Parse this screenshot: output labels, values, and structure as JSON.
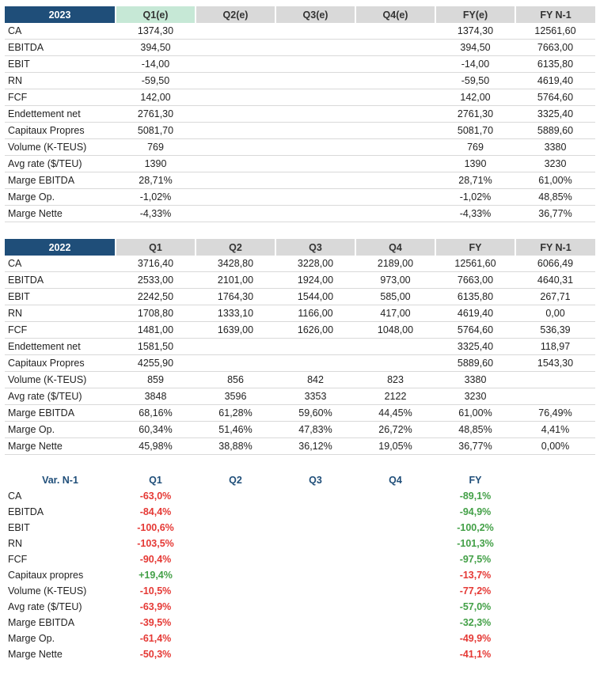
{
  "table_2023": {
    "headers": [
      "2023",
      "Q1(e)",
      "Q2(e)",
      "Q3(e)",
      "Q4(e)",
      "FY(e)",
      "FY N-1"
    ],
    "rows": [
      [
        "CA",
        "1374,30",
        "",
        "",
        "",
        "1374,30",
        "12561,60"
      ],
      [
        "EBITDA",
        "394,50",
        "",
        "",
        "",
        "394,50",
        "7663,00"
      ],
      [
        "EBIT",
        "-14,00",
        "",
        "",
        "",
        "-14,00",
        "6135,80"
      ],
      [
        "RN",
        "-59,50",
        "",
        "",
        "",
        "-59,50",
        "4619,40"
      ],
      [
        "FCF",
        "142,00",
        "",
        "",
        "",
        "142,00",
        "5764,60"
      ],
      [
        "Endettement net",
        "2761,30",
        "",
        "",
        "",
        "2761,30",
        "3325,40"
      ],
      [
        "Capitaux Propres",
        "5081,70",
        "",
        "",
        "",
        "5081,70",
        "5889,60"
      ],
      [
        "Volume (K-TEUS)",
        "769",
        "",
        "",
        "",
        "769",
        "3380"
      ],
      [
        "Avg rate ($/TEU)",
        "1390",
        "",
        "",
        "",
        "1390",
        "3230"
      ],
      [
        "Marge EBITDA",
        "28,71%",
        "",
        "",
        "",
        "28,71%",
        "61,00%"
      ],
      [
        "Marge Op.",
        "-1,02%",
        "",
        "",
        "",
        "-1,02%",
        "48,85%"
      ],
      [
        "Marge Nette",
        "-4,33%",
        "",
        "",
        "",
        "-4,33%",
        "36,77%"
      ]
    ]
  },
  "table_2022": {
    "headers": [
      "2022",
      "Q1",
      "Q2",
      "Q3",
      "Q4",
      "FY",
      "FY N-1"
    ],
    "rows": [
      [
        "CA",
        "3716,40",
        "3428,80",
        "3228,00",
        "2189,00",
        "12561,60",
        "6066,49"
      ],
      [
        "EBITDA",
        "2533,00",
        "2101,00",
        "1924,00",
        "973,00",
        "7663,00",
        "4640,31"
      ],
      [
        "EBIT",
        "2242,50",
        "1764,30",
        "1544,00",
        "585,00",
        "6135,80",
        "267,71"
      ],
      [
        "RN",
        "1708,80",
        "1333,10",
        "1166,00",
        "417,00",
        "4619,40",
        "0,00"
      ],
      [
        "FCF",
        "1481,00",
        "1639,00",
        "1626,00",
        "1048,00",
        "5764,60",
        "536,39"
      ],
      [
        "Endettement net",
        "1581,50",
        "",
        "",
        "",
        "3325,40",
        "118,97"
      ],
      [
        "Capitaux Propres",
        "4255,90",
        "",
        "",
        "",
        "5889,60",
        "1543,30"
      ],
      [
        "Volume (K-TEUS)",
        "859",
        "856",
        "842",
        "823",
        "3380",
        ""
      ],
      [
        "Avg rate ($/TEU)",
        "3848",
        "3596",
        "3353",
        "2122",
        "3230",
        ""
      ],
      [
        "Marge EBITDA",
        "68,16%",
        "61,28%",
        "59,60%",
        "44,45%",
        "61,00%",
        "76,49%"
      ],
      [
        "Marge Op.",
        "60,34%",
        "51,46%",
        "47,83%",
        "26,72%",
        "48,85%",
        "4,41%"
      ],
      [
        "Marge Nette",
        "45,98%",
        "38,88%",
        "36,12%",
        "19,05%",
        "36,77%",
        "0,00%"
      ]
    ]
  },
  "table_var": {
    "headers": [
      "Var. N-1",
      "Q1",
      "Q2",
      "Q3",
      "Q4",
      "FY"
    ],
    "rows": [
      [
        "CA",
        "-63,0%",
        "",
        "",
        "",
        "-89,1%"
      ],
      [
        "EBITDA",
        "-84,4%",
        "",
        "",
        "",
        "-94,9%"
      ],
      [
        "EBIT",
        "-100,6%",
        "",
        "",
        "",
        "-100,2%"
      ],
      [
        "RN",
        "-103,5%",
        "",
        "",
        "",
        "-101,3%"
      ],
      [
        "FCF",
        "-90,4%",
        "",
        "",
        "",
        "-97,5%"
      ],
      [
        "Capitaux propres",
        "+19,4%",
        "",
        "",
        "",
        "-13,7%"
      ],
      [
        "Volume (K-TEUS)",
        "-10,5%",
        "",
        "",
        "",
        "-77,2%"
      ],
      [
        "Avg rate ($/TEU)",
        "-63,9%",
        "",
        "",
        "",
        "-57,0%"
      ],
      [
        "Marge EBITDA",
        "-39,5%",
        "",
        "",
        "",
        "-32,3%"
      ],
      [
        "Marge Op.",
        "-61,4%",
        "",
        "",
        "",
        "-49,9%"
      ],
      [
        "Marge Nette",
        "-50,3%",
        "",
        "",
        "",
        "-41,1%"
      ]
    ],
    "q1_colors": [
      "red",
      "red",
      "red",
      "red",
      "red",
      "green",
      "red",
      "red",
      "red",
      "red",
      "red"
    ],
    "fy_colors": [
      "green",
      "green",
      "green",
      "green",
      "green",
      "red",
      "red",
      "green",
      "green",
      "red",
      "red"
    ]
  },
  "colors": {
    "header_year": "#1f4e79",
    "header_active": "#c6e8d6",
    "header_gray": "#d9d9d9",
    "negative": "#e53935",
    "positive": "#43a047"
  }
}
